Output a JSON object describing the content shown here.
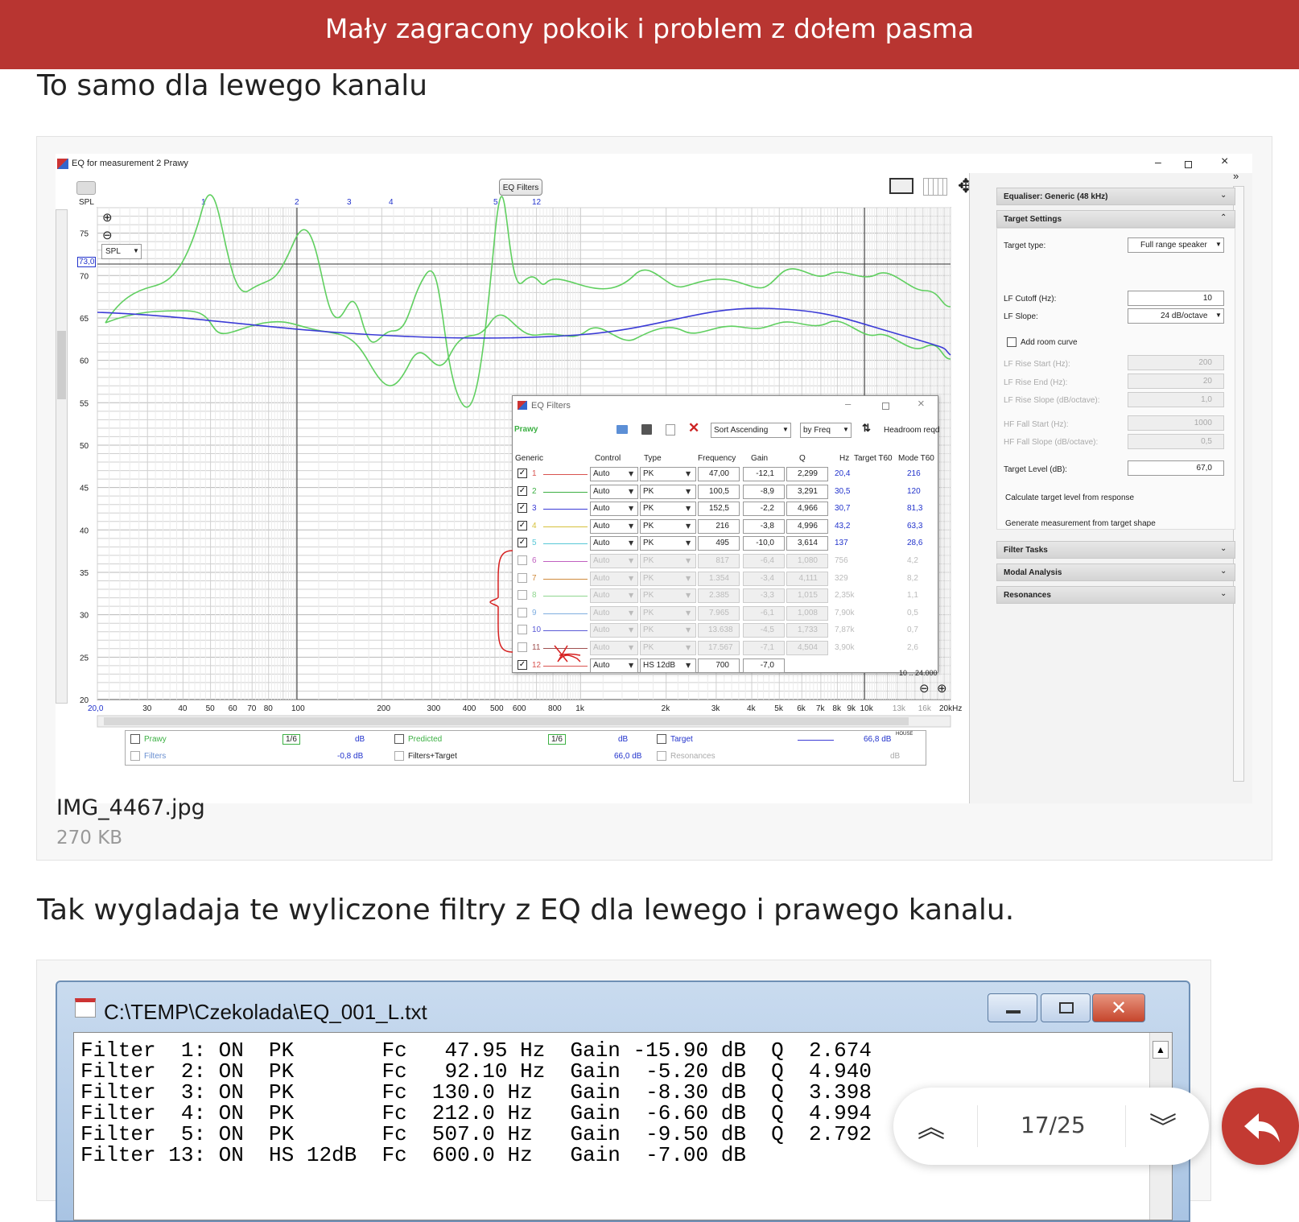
{
  "header": {
    "title": "Mały zagracony pokoik i problem z dołem pasma"
  },
  "post": {
    "para1": "To samo dla lewego kanalu",
    "para2": "Tak wygladaja te wyliczone filtry z EQ dla lewego i prawego kanalu.",
    "attachment1": {
      "filename": "IMG_4467.jpg",
      "size": "270 KB"
    },
    "attachment2": {
      "window_title": "C:\\TEMP\\Czekolada\\EQ_001_L.txt"
    }
  },
  "rew": {
    "window_title": "EQ for measurement 2 Prawy",
    "eq_filters_button": "EQ Filters",
    "spl_label": "SPL",
    "spl_select": "SPL",
    "top_markers": [
      "1",
      "2",
      "3",
      "4",
      "5",
      "12"
    ],
    "current_value": "73,0",
    "y_ticks": [
      "75",
      "70",
      "65",
      "60",
      "55",
      "50",
      "45",
      "40",
      "35",
      "30",
      "25",
      "20"
    ],
    "x_ticks": [
      "20,0",
      "30",
      "40",
      "50",
      "60",
      "70",
      "80",
      "100",
      "200",
      "300",
      "400",
      "500",
      "600",
      "800",
      "1k",
      "2k",
      "3k",
      "4k",
      "5k",
      "6k",
      "7k",
      "8k",
      "9k",
      "10k",
      "13k",
      "16k",
      "20kHz"
    ],
    "range_label": "10 .. 24.000",
    "legend": {
      "prawy": "Prawy",
      "prawy_smooth": "1/6",
      "prawy_unit": "dB",
      "filters": "Filters",
      "filters_val": "-0,8 dB",
      "predicted": "Predicted",
      "predicted_smooth": "1/6",
      "predicted_unit": "dB",
      "filters_target": "Filters+Target",
      "filters_target_val": "66,0 dB",
      "target": "Target",
      "target_val": "66,8 dB",
      "target_sup": "HOUSE",
      "resonances": "Resonances",
      "resonances_unit": "dB"
    },
    "side": {
      "equaliser": "Equaliser: Generic (48 kHz)",
      "target_settings": "Target Settings",
      "target_type_label": "Target type:",
      "target_type": "Full range speaker",
      "lf_cutoff_label": "LF Cutoff (Hz):",
      "lf_cutoff": "10",
      "lf_slope_label": "LF Slope:",
      "lf_slope": "24 dB/octave",
      "add_room_curve": "Add room curve",
      "lf_rise_start_label": "LF Rise Start (Hz):",
      "lf_rise_start": "200",
      "lf_rise_end_label": "LF Rise End (Hz):",
      "lf_rise_end": "20",
      "lf_rise_slope_label": "LF Rise Slope (dB/octave):",
      "lf_rise_slope": "1,0",
      "hf_fall_start_label": "HF Fall Start (Hz):",
      "hf_fall_start": "1000",
      "hf_fall_slope_label": "HF Fall Slope (dB/octave):",
      "hf_fall_slope": "0,5",
      "target_level_label": "Target Level (dB):",
      "target_level": "67,0",
      "calc_target": "Calculate target level from response",
      "gen_measurement": "Generate measurement from target shape",
      "filter_tasks": "Filter Tasks",
      "modal_analysis": "Modal Analysis",
      "resonances": "Resonances"
    },
    "eqf": {
      "title": "EQ Filters",
      "channel": "Prawy",
      "sort": "Sort Ascending",
      "by": "by Freq",
      "headroom": "Headroom reqd",
      "headers": [
        "Generic",
        "Control",
        "Type",
        "Frequency",
        "Gain",
        "Q",
        "Hz",
        "Target T60",
        "Mode T60"
      ],
      "rows": [
        {
          "n": "1",
          "ctl": "Auto",
          "type": "PK",
          "freq": "47,00",
          "gain": "-12,1",
          "q": "2,299",
          "hz": "20,4",
          "t60": "216",
          "on": true,
          "color": "#d9534f"
        },
        {
          "n": "2",
          "ctl": "Auto",
          "type": "PK",
          "freq": "100,5",
          "gain": "-8,9",
          "q": "3,291",
          "hz": "30,5",
          "t60": "120",
          "on": true,
          "color": "#3cb043"
        },
        {
          "n": "3",
          "ctl": "Auto",
          "type": "PK",
          "freq": "152,5",
          "gain": "-2,2",
          "q": "4,966",
          "hz": "30,7",
          "t60": "81,3",
          "on": true,
          "color": "#3b3bd6"
        },
        {
          "n": "4",
          "ctl": "Auto",
          "type": "PK",
          "freq": "216",
          "gain": "-3,8",
          "q": "4,996",
          "hz": "43,2",
          "t60": "63,3",
          "on": true,
          "color": "#d6c13b"
        },
        {
          "n": "5",
          "ctl": "Auto",
          "type": "PK",
          "freq": "495",
          "gain": "-10,0",
          "q": "3,614",
          "hz": "137",
          "t60": "28,6",
          "on": true,
          "color": "#57c7d6"
        },
        {
          "n": "6",
          "ctl": "Auto",
          "type": "PK",
          "freq": "817",
          "gain": "-6,4",
          "q": "1,080",
          "hz": "756",
          "t60": "4,2",
          "on": false,
          "color": "#c060c0"
        },
        {
          "n": "7",
          "ctl": "Auto",
          "type": "PK",
          "freq": "1.354",
          "gain": "-3,4",
          "q": "4,111",
          "hz": "329",
          "t60": "8,2",
          "on": false,
          "color": "#d08a3c"
        },
        {
          "n": "8",
          "ctl": "Auto",
          "type": "PK",
          "freq": "2.385",
          "gain": "-3,3",
          "q": "1,015",
          "hz": "2,35k",
          "t60": "1,1",
          "on": false,
          "color": "#8fd68f"
        },
        {
          "n": "9",
          "ctl": "Auto",
          "type": "PK",
          "freq": "7.965",
          "gain": "-6,1",
          "q": "1,008",
          "hz": "7,90k",
          "t60": "0,5",
          "on": false,
          "color": "#7faee0"
        },
        {
          "n": "10",
          "ctl": "Auto",
          "type": "PK",
          "freq": "13.638",
          "gain": "-4,5",
          "q": "1,733",
          "hz": "7,87k",
          "t60": "0,7",
          "on": false,
          "color": "#5a5ad6"
        },
        {
          "n": "11",
          "ctl": "Auto",
          "type": "PK",
          "freq": "17.567",
          "gain": "-7,1",
          "q": "4,504",
          "hz": "3,90k",
          "t60": "2,6",
          "on": false,
          "color": "#a05050"
        },
        {
          "n": "12",
          "ctl": "Auto",
          "type": "HS 12dB",
          "freq": "700",
          "gain": "-7,0",
          "q": "",
          "hz": "",
          "t60": "",
          "on": true,
          "color": "#d9534f"
        }
      ]
    }
  },
  "console_lines": [
    "Filter  1: ON  PK       Fc   47.95 Hz  Gain -15.90 dB  Q  2.674",
    "Filter  2: ON  PK       Fc   92.10 Hz  Gain  -5.20 dB  Q  4.940",
    "Filter  3: ON  PK       Fc  130.0 Hz   Gain  -8.30 dB  Q  3.398",
    "Filter  4: ON  PK       Fc  212.0 Hz   Gain  -6.60 dB  Q  4.994",
    "Filter  5: ON  PK       Fc  507.0 Hz   Gain  -9.50 dB  Q  2.792",
    "Filter 13: ON  HS 12dB  Fc  600.0 Hz   Gain  -7.00 dB"
  ],
  "pager": {
    "label": "17/25"
  },
  "colors": {
    "accent": "#b83531",
    "measurement": "#5fcf5f",
    "target": "#3b3bd6",
    "annotation": "#d62020"
  }
}
